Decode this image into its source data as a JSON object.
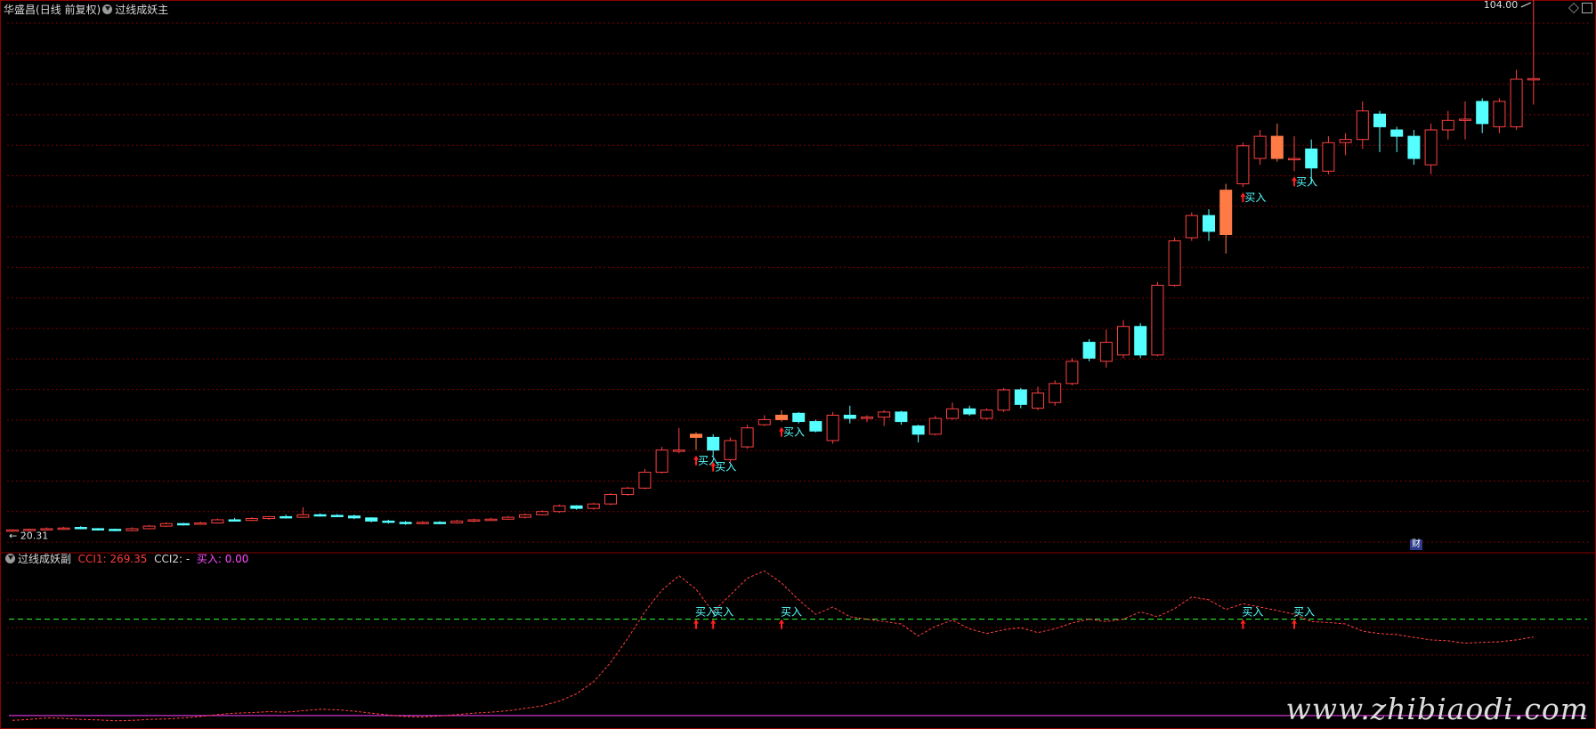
{
  "main_panel": {
    "stock_name": "华盛昌",
    "period_label": "(日线 前复权)",
    "indicator_name": "过线成妖主",
    "high_label": "104.00",
    "low_label": "20.31"
  },
  "sub_panel": {
    "indicator_name": "过线成妖副",
    "cci1_text": "CCI1: 269.35",
    "cci2_text": "CCI2: -",
    "buy_text": "买入: 0.00",
    "buy_mark_label": "买入"
  },
  "badge": "财",
  "watermark": "www.zhibiaodi.com",
  "colors": {
    "up": "#ff4040",
    "down": "#55ffff",
    "highlight": "#ff7a45",
    "grid": "#7a0000",
    "signal_line": "#33ff33",
    "baseline": "#cc33cc",
    "buy_text": "#55ffff",
    "buy_arrow": "#ff2020",
    "border": "#8b0000"
  },
  "chart_data": [
    {
      "type": "candlestick",
      "title": "华盛昌 (日线 前复权)",
      "ylim": [
        20.31,
        104.0
      ],
      "candles": [
        [
          20.2,
          20.4,
          20.1,
          20.5
        ],
        [
          20.3,
          20.5,
          20.2,
          20.6
        ],
        [
          20.4,
          20.6,
          20.3,
          20.8
        ],
        [
          20.6,
          20.7,
          20.4,
          20.9
        ],
        [
          20.8,
          20.6,
          20.5,
          21.0
        ],
        [
          20.6,
          20.5,
          20.3,
          20.7
        ],
        [
          20.5,
          20.3,
          20.2,
          20.6
        ],
        [
          20.3,
          20.6,
          20.2,
          20.8
        ],
        [
          20.6,
          21.0,
          20.5,
          21.2
        ],
        [
          21.0,
          21.4,
          20.9,
          21.6
        ],
        [
          21.4,
          21.3,
          21.1,
          21.5
        ],
        [
          21.3,
          21.5,
          21.2,
          21.7
        ],
        [
          21.5,
          22.0,
          21.4,
          22.2
        ],
        [
          22.0,
          21.9,
          21.8,
          22.3
        ],
        [
          21.9,
          22.2,
          21.8,
          22.4
        ],
        [
          22.2,
          22.5,
          22.0,
          22.6
        ],
        [
          22.5,
          22.4,
          22.2,
          22.8
        ],
        [
          22.4,
          22.8,
          22.3,
          24.0
        ],
        [
          22.8,
          22.7,
          22.5,
          23.0
        ],
        [
          22.7,
          22.6,
          22.4,
          22.9
        ],
        [
          22.6,
          22.3,
          22.1,
          22.8
        ],
        [
          22.3,
          21.8,
          21.6,
          22.4
        ],
        [
          21.8,
          21.6,
          21.4,
          22.0
        ],
        [
          21.6,
          21.4,
          21.2,
          21.8
        ],
        [
          21.4,
          21.6,
          21.3,
          21.8
        ],
        [
          21.6,
          21.5,
          21.3,
          21.8
        ],
        [
          21.5,
          21.8,
          21.4,
          22.0
        ],
        [
          21.8,
          22.0,
          21.6,
          22.2
        ],
        [
          22.0,
          22.1,
          21.8,
          22.3
        ],
        [
          22.1,
          22.4,
          22.0,
          22.6
        ],
        [
          22.4,
          22.8,
          22.2,
          23.0
        ],
        [
          22.8,
          23.3,
          22.7,
          23.5
        ],
        [
          23.3,
          24.2,
          23.1,
          24.4
        ],
        [
          24.2,
          23.8,
          23.6,
          24.3
        ],
        [
          23.8,
          24.5,
          23.6,
          24.7
        ],
        [
          24.5,
          26.0,
          24.3,
          26.2
        ],
        [
          26.0,
          27.0,
          25.8,
          27.2
        ],
        [
          27.0,
          29.5,
          26.8,
          30.0
        ],
        [
          29.5,
          33.0,
          29.3,
          33.5
        ],
        [
          33.0,
          33.0,
          32.5,
          36.5
        ],
        [
          35.5,
          35.0,
          33.0,
          35.8
        ],
        [
          35.0,
          33.0,
          32.0,
          35.5
        ],
        [
          31.5,
          34.5,
          31.0,
          35.0
        ],
        [
          33.5,
          36.5,
          33.2,
          37.0
        ],
        [
          37.0,
          37.8,
          36.8,
          38.5
        ],
        [
          37.8,
          38.5,
          37.5,
          39.3
        ],
        [
          38.8,
          37.5,
          37.2,
          39.0
        ],
        [
          37.5,
          36.0,
          35.8,
          37.8
        ],
        [
          34.5,
          38.5,
          34.0,
          39.0
        ],
        [
          38.5,
          38.0,
          37.2,
          40.0
        ],
        [
          38.0,
          38.2,
          37.4,
          38.5
        ],
        [
          38.2,
          39.0,
          36.8,
          39.3
        ],
        [
          39.0,
          37.5,
          37.0,
          39.2
        ],
        [
          36.8,
          35.5,
          34.2,
          37.0
        ],
        [
          35.5,
          38.0,
          35.3,
          38.4
        ],
        [
          38.0,
          39.5,
          37.8,
          40.5
        ],
        [
          39.5,
          38.7,
          38.4,
          40.0
        ],
        [
          38.0,
          39.3,
          37.8,
          39.6
        ],
        [
          39.3,
          42.5,
          39.0,
          42.8
        ],
        [
          42.5,
          40.2,
          39.6,
          42.8
        ],
        [
          39.6,
          42.0,
          39.3,
          43.0
        ],
        [
          40.5,
          43.5,
          40.0,
          44.0
        ],
        [
          43.5,
          47.0,
          43.2,
          47.5
        ],
        [
          50.0,
          47.5,
          47.0,
          50.5
        ],
        [
          47.0,
          50.0,
          46.0,
          52.0
        ],
        [
          48.0,
          52.5,
          47.5,
          53.5
        ],
        [
          52.5,
          48.0,
          47.5,
          53.0
        ],
        [
          48.0,
          59.0,
          47.8,
          59.5
        ],
        [
          59.0,
          66.0,
          58.8,
          66.5
        ],
        [
          66.5,
          70.0,
          66.0,
          70.5
        ],
        [
          70.0,
          67.5,
          66.0,
          71.0
        ],
        [
          67.0,
          74.0,
          64.0,
          75.0
        ],
        [
          75.0,
          81.0,
          74.5,
          81.5
        ],
        [
          79.0,
          82.5,
          78.0,
          83.5
        ],
        [
          82.5,
          79.0,
          78.5,
          84.5
        ],
        [
          79.0,
          79.0,
          77.0,
          82.5
        ],
        [
          80.5,
          77.5,
          75.0,
          82.0
        ],
        [
          77.0,
          81.5,
          76.5,
          82.5
        ],
        [
          81.5,
          82.0,
          79.5,
          83.0
        ],
        [
          82.0,
          86.5,
          80.5,
          88.0
        ],
        [
          86.0,
          84.0,
          80.0,
          86.5
        ],
        [
          83.5,
          82.5,
          80.0,
          84.0
        ],
        [
          82.5,
          79.0,
          78.0,
          83.5
        ],
        [
          78.0,
          83.5,
          76.5,
          84.5
        ],
        [
          83.5,
          85.0,
          82.0,
          86.5
        ],
        [
          85.0,
          85.2,
          82.0,
          88.0
        ],
        [
          88.0,
          84.5,
          83.0,
          88.5
        ],
        [
          84.0,
          88.0,
          83.0,
          88.5
        ],
        [
          84.0,
          91.5,
          83.5,
          93.0
        ],
        [
          91.5,
          91.6,
          87.5,
          104.0
        ]
      ],
      "highlighted_candles": [
        40,
        45,
        71,
        74
      ],
      "buy_signals": [
        40,
        41,
        45,
        72,
        75
      ],
      "buy_label": "买入"
    },
    {
      "type": "line",
      "title": "过线成妖副",
      "series": [
        {
          "name": "CCI1",
          "style": "dashed",
          "values": [
            -10,
            -8,
            -5,
            -6,
            -8,
            -9,
            -11,
            -10,
            -8,
            -7,
            -5,
            -2,
            2,
            5,
            6,
            8,
            7,
            10,
            13,
            12,
            9,
            5,
            1,
            -2,
            -3,
            -1,
            2,
            5,
            7,
            10,
            15,
            20,
            30,
            45,
            70,
            110,
            160,
            215,
            260,
            290,
            262,
            215,
            250,
            285,
            300,
            275,
            240,
            210,
            225,
            205,
            200,
            195,
            190,
            165,
            185,
            198,
            180,
            170,
            178,
            182,
            172,
            180,
            192,
            200,
            195,
            200,
            215,
            205,
            222,
            246,
            240,
            220,
            232,
            225,
            218,
            210,
            195,
            193,
            190,
            175,
            170,
            168,
            162,
            157,
            155,
            150,
            152,
            153,
            157,
            163
          ]
        },
        {
          "name": "CCI2",
          "style": "solid",
          "values": []
        }
      ],
      "reference_levels": [
        200,
        0
      ],
      "buy_signals": [
        40,
        41,
        45,
        72,
        75
      ],
      "buy_label": "买入",
      "ylim": [
        -15,
        310
      ]
    }
  ]
}
